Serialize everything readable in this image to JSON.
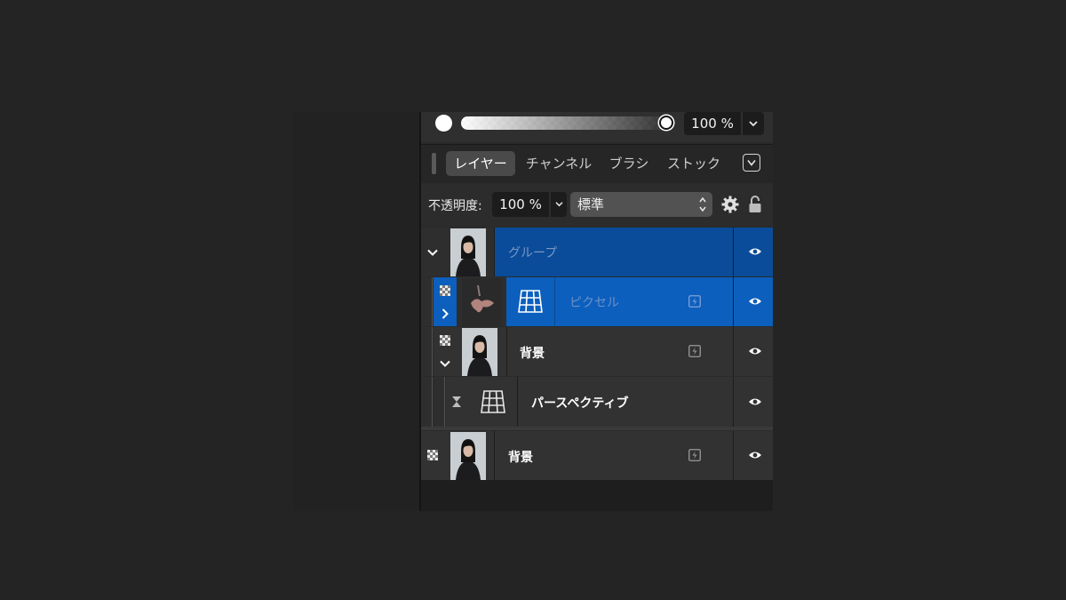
{
  "top_strip": {
    "opacity_value": "100 %",
    "dropdown_glyph": "⌄"
  },
  "tabs": [
    {
      "label": "レイヤー",
      "active": true
    },
    {
      "label": "チャンネル",
      "active": false
    },
    {
      "label": "ブラシ",
      "active": false
    },
    {
      "label": "ストック",
      "active": false
    }
  ],
  "tab_menu_glyph": "∨",
  "options": {
    "opacity_label": "不透明度:",
    "opacity_value": "100 %",
    "blend_mode": "標準"
  },
  "layers": [
    {
      "name": "グループ",
      "type": "group",
      "selected": "group",
      "expanded": true
    },
    {
      "name": "ピクセル",
      "type": "pixel",
      "selected": true,
      "expanded": false
    },
    {
      "name": "背景",
      "type": "image",
      "selected": false,
      "expanded": true
    },
    {
      "name": "パースペクティブ",
      "type": "perspective-filter",
      "selected": false
    },
    {
      "name": "背景",
      "type": "image",
      "selected": false
    }
  ],
  "icons": {
    "eye": "eye-icon",
    "lightning": "lightning-icon",
    "gear": "gear-icon",
    "lock": "lock-icon",
    "mesh": "mesh-grid-icon",
    "hourglass": "hourglass-icon",
    "checker": "checker-icon"
  },
  "colors": {
    "selected_blue": "#0c5fbd",
    "group_blue": "#0a4c99",
    "panel_bg": "#2a2a2a"
  }
}
